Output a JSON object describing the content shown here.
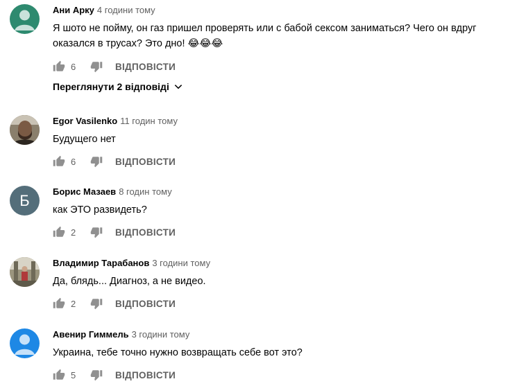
{
  "comments": [
    {
      "author": "Ани Арку",
      "time": "4 години тому",
      "text": "Я шото не пойму, он газ пришел проверять или с бабой сексом заниматься? Чего он вдруг оказался в трусах? Это дно! 😂😂😂",
      "likes": "6",
      "reply_label": "ВІДПОВІСТИ",
      "avatar": {
        "type": "default",
        "color": "#2e8a6f"
      },
      "view_replies": "Переглянути 2 відповіді"
    },
    {
      "author": "Egor Vasilenko",
      "time": "11 годин тому",
      "text": "Будущего нет",
      "likes": "6",
      "reply_label": "ВІДПОВІСТИ",
      "avatar": {
        "type": "photo",
        "description": "man-portrait"
      }
    },
    {
      "author": "Борис Мазаев",
      "time": "8 годин тому",
      "text": "как ЭТО развидеть?",
      "likes": "2",
      "reply_label": "ВІДПОВІСТИ",
      "avatar": {
        "type": "letter",
        "letter": "Б",
        "color": "#546e7a"
      }
    },
    {
      "author": "Владимир Тарабанов",
      "time": "3 години тому",
      "text": "Да, блядь... Диагноз, а не видео.",
      "likes": "2",
      "reply_label": "ВІДПОВІСТИ",
      "avatar": {
        "type": "photo",
        "description": "figure-photo"
      }
    },
    {
      "author": "Авенир Гиммель",
      "time": "3 години тому",
      "text": "Украина, тебе точно нужно возвращать себе вот это?",
      "likes": "5",
      "reply_label": "ВІДПОВІСТИ",
      "avatar": {
        "type": "default",
        "color": "#1e88e5"
      }
    }
  ]
}
